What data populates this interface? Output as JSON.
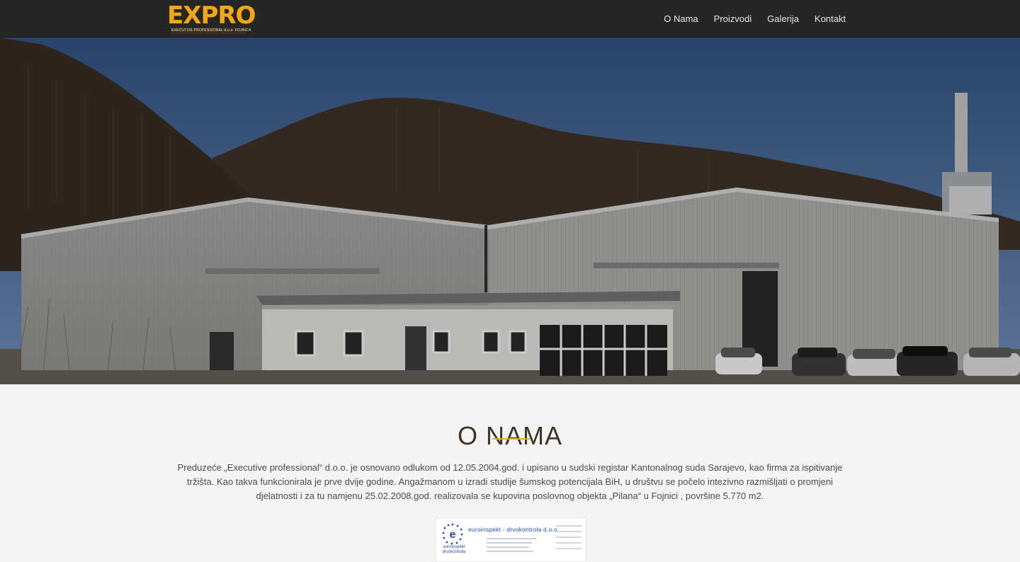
{
  "header": {
    "logo_text": "EXPRO",
    "logo_subtitle": "EXECUTIVE PROFESSIONAL d.o.o. FOJNICA",
    "nav": [
      {
        "label": "O Nama"
      },
      {
        "label": "Proizvodi"
      },
      {
        "label": "Galerija"
      },
      {
        "label": "Kontakt"
      }
    ]
  },
  "about": {
    "title": "O NAMA",
    "text": "Preduzeće „Executive professional“ d.o.o. je osnovano odlukom od 12.05.2004.god. i upisano u sudski registar Kantonalnog suda Sarajevo, kao firma za ispitivanje tržišta. Kao takva funkcionirala je prve dvije godine. Angažmanom u izradi studije šumskog potencijala BiH, u društvu se počelo intezivno razmišljati o promjeni djelatnosti i za tu namjenu 25.02.2008.god. realizovala se kupovina poslovnog objekta „Pilana“ u Fojnici , površine 5.770 m2."
  },
  "partner": {
    "name": "euroinspekt - drvokontrola d.o.o.",
    "logo_label": "euroinspekt drvokontrola"
  },
  "colors": {
    "navbar": "#262626",
    "logo": "#f2a71b",
    "accent_rule": "#d6b13c",
    "title": "#3f3427"
  }
}
